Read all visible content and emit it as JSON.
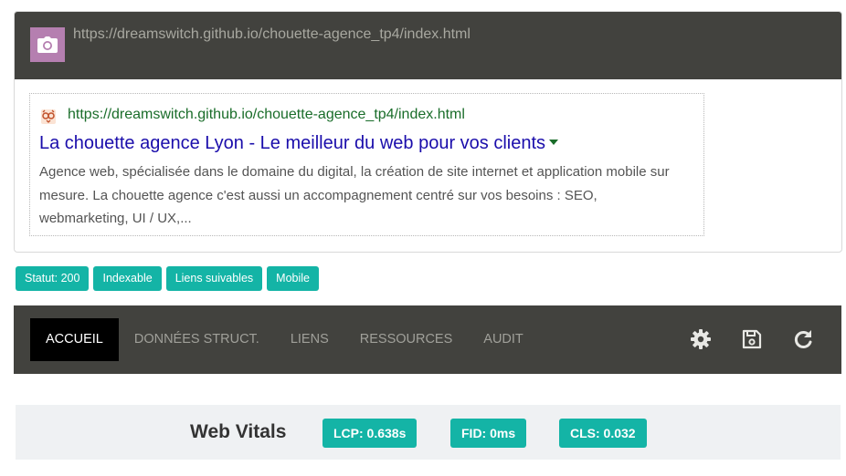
{
  "header": {
    "url": "https://dreamswitch.github.io/chouette-agence_tp4/index.html",
    "camera_icon": "camera-icon",
    "camera_bg": "#b57fb0"
  },
  "serp": {
    "favicon": "owl-favicon-icon",
    "url": "https://dreamswitch.github.io/chouette-agence_tp4/index.html",
    "title": "La chouette agence Lyon - Le meilleur du web pour vos clients",
    "description": "Agence web, spécialisée dans le domaine du digital, la création de site internet et application mobile sur mesure. La chouette agence c'est aussi un accompagnement centré sur vos besoins : SEO, webmarketing, UI / UX,...",
    "title_color": "#1a0dab",
    "url_color": "#1a6d2a"
  },
  "badges": [
    "Statut: 200",
    "Indexable",
    "Liens suivables",
    "Mobile"
  ],
  "badge_color": "#14b4a6",
  "nav": {
    "tabs": [
      "ACCUEIL",
      "DONNÉES STRUCT.",
      "LIENS",
      "RESSOURCES",
      "AUDIT"
    ],
    "active_tab": "ACCUEIL",
    "icons": [
      "gear-icon",
      "save-icon",
      "refresh-icon"
    ]
  },
  "vitals": {
    "title": "Web Vitals",
    "lcp": "LCP:  0.638s",
    "fid": "FID:  0ms",
    "cls": "CLS:  0.032"
  }
}
